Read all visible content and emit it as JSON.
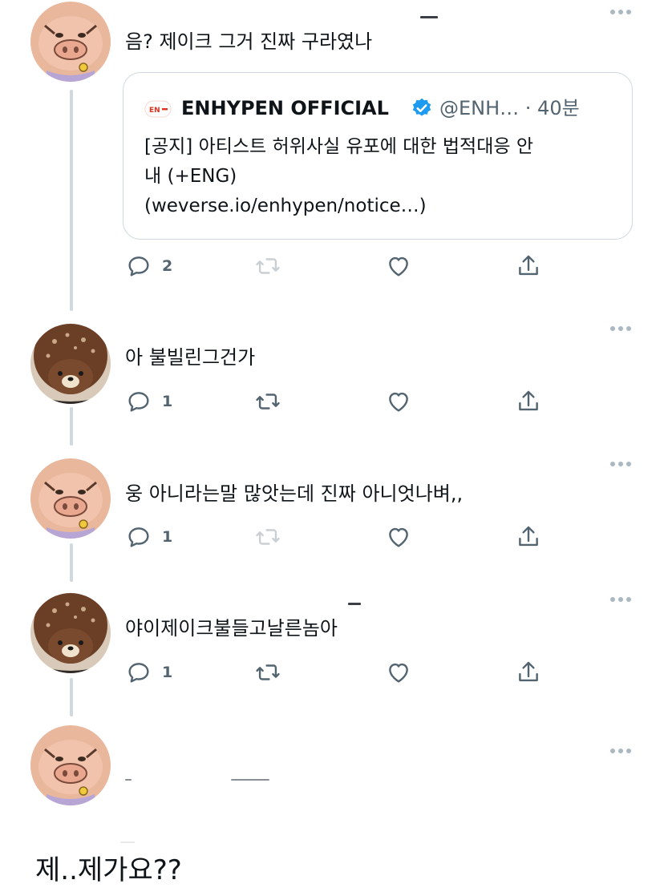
{
  "tweets": [
    {
      "text": "음? 제이크 그거 진짜 구라였나",
      "quote": {
        "name": "ENHYPEN OFFICIAL",
        "handle_time": "@ENH… · 40분",
        "body_lines": [
          "[공지] 아티스트 허위사실 유포에 대한 법적대응 안",
          "내 (+ENG)",
          "(weverse.io/enhypen/notice…)"
        ]
      },
      "reply_count": "2"
    },
    {
      "text": "아 불빌린그건가",
      "reply_count": "1"
    },
    {
      "text": "웅 아니라는말 많앗는데 진짜 아니엇나벼,,",
      "reply_count": "1"
    },
    {
      "text": "야이제이크불들고날른놈아",
      "reply_count": "1"
    },
    {
      "text": ""
    }
  ],
  "caption": "제..제가요??",
  "icons": {
    "avatar_a": "pig-character-avatar",
    "avatar_b": "brown-bear-avatar",
    "verified": "verified-badge-icon",
    "reply": "reply-icon",
    "retweet": "retweet-icon",
    "like": "heart-icon",
    "share": "share-icon",
    "more": "more-icon"
  },
  "colors": {
    "verified": "#1d9bf0",
    "icon_gray": "#536471",
    "border": "#cfd9de",
    "enhypen_red": "#e0321d"
  }
}
